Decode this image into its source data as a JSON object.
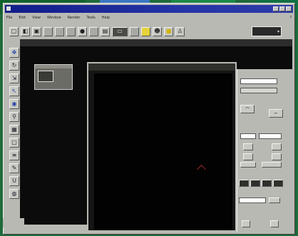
{
  "window": {
    "title": ""
  },
  "menu": {
    "items": [
      "File",
      "Edit",
      "View",
      "Window",
      "Render",
      "Tools",
      "Help"
    ],
    "help": "?"
  },
  "toolbar": {
    "zoom_value": ""
  },
  "statusbar": {
    "text": ""
  },
  "properties": {
    "sections": [
      {
        "label": ""
      },
      {
        "label": ""
      },
      {
        "label": ""
      },
      {
        "label": ""
      }
    ],
    "fields": [
      {
        "value": ""
      },
      {
        "value": ""
      },
      {
        "value": ""
      },
      {
        "value": ""
      },
      {
        "value": ""
      }
    ]
  },
  "colors": {
    "titlebar": "#101c88",
    "workspace": "#0b0b0b",
    "chrome": "#b9b9b4",
    "desktop": "#1f6a3b"
  },
  "icons": [
    "new-icon",
    "open-icon",
    "save-icon",
    "render-icon",
    "camera-icon",
    "light-icon",
    "yellow-box-icon",
    "figure-icon",
    "move-icon",
    "rotate-icon",
    "scale-icon",
    "select-icon",
    "zoom-icon"
  ]
}
